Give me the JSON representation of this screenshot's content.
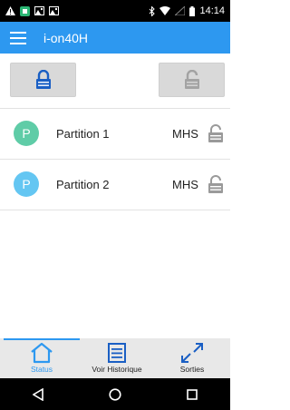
{
  "status_bar": {
    "time": "14:14",
    "left_icons": [
      "warning-icon",
      "app-icon",
      "photo-icon",
      "photo-icon"
    ],
    "right_icons": [
      "bluetooth-icon",
      "wifi-icon",
      "signal-icon",
      "battery-icon"
    ]
  },
  "app_bar": {
    "title": "i-on40H",
    "color": "#2d98f0"
  },
  "arm_buttons": {
    "arm_icon": "padlock-closed-icon",
    "disarm_icon": "padlock-open-icon"
  },
  "partitions": [
    {
      "initial": "P",
      "name": "Partition 1",
      "status": "MHS",
      "avatar_color": "#5fcca7",
      "lock_icon": "padlock-open-icon"
    },
    {
      "initial": "P",
      "name": "Partition 2",
      "status": "MHS",
      "avatar_color": "#64c6f2",
      "lock_icon": "padlock-open-icon"
    }
  ],
  "bottom_nav": {
    "items": [
      {
        "label": "Status",
        "icon": "home-icon",
        "active": true
      },
      {
        "label": "Voir Historique",
        "icon": "list-icon",
        "active": false
      },
      {
        "label": "Sorties",
        "icon": "outputs-arrows-icon",
        "active": false
      }
    ]
  },
  "system_nav": {
    "icons": [
      "back-icon",
      "home-circle-icon",
      "recents-icon"
    ]
  }
}
